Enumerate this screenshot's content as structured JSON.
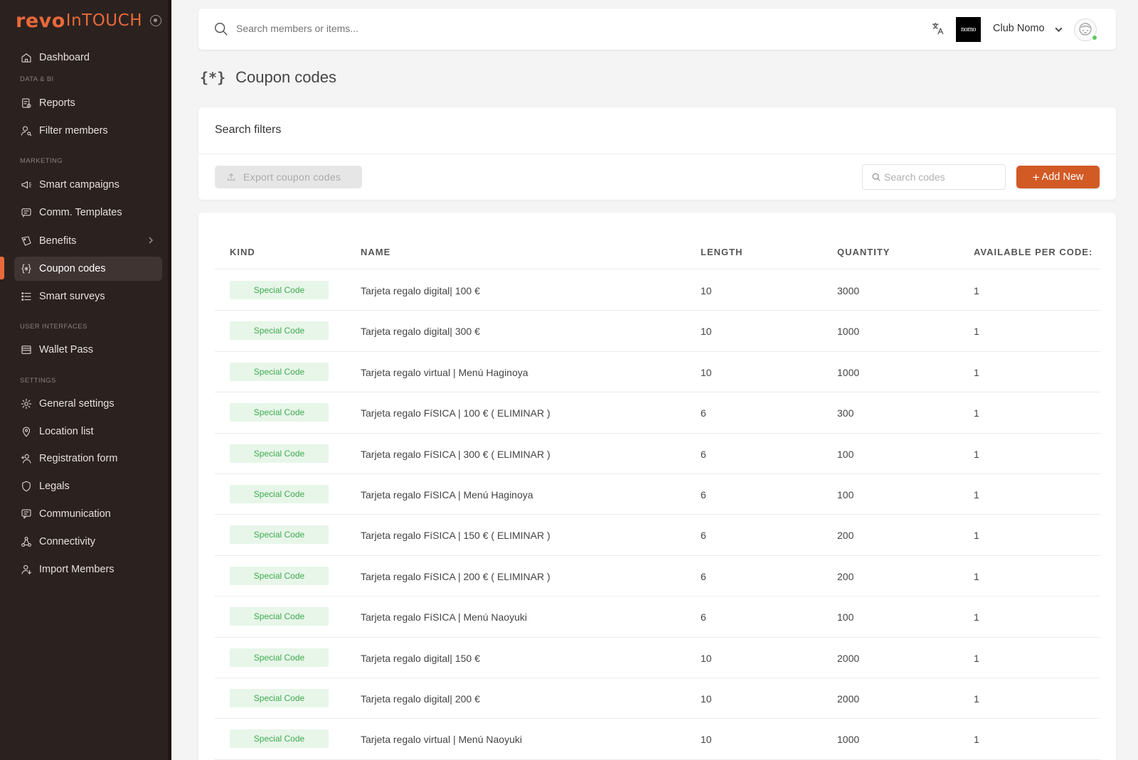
{
  "brand": {
    "logo_main": "revo",
    "logo_sub": "InTOUCH"
  },
  "sidebar": {
    "items": [
      {
        "id": "dashboard",
        "label": "Dashboard",
        "icon": "home-icon"
      },
      {
        "id": "reports",
        "label": "Reports",
        "icon": "reports-icon"
      },
      {
        "id": "filter-members",
        "label": "Filter members",
        "icon": "user-search-icon"
      },
      {
        "id": "smart-campaigns",
        "label": "Smart campaigns",
        "icon": "megaphone-icon"
      },
      {
        "id": "comm-templates",
        "label": "Comm. Templates",
        "icon": "message-icon"
      },
      {
        "id": "benefits",
        "label": "Benefits",
        "icon": "tag-icon"
      },
      {
        "id": "coupon-codes",
        "label": "Coupon codes",
        "icon": "braces-asterisk-icon"
      },
      {
        "id": "smart-surveys",
        "label": "Smart surveys",
        "icon": "list-icon"
      },
      {
        "id": "wallet-pass",
        "label": "Wallet Pass",
        "icon": "wallet-icon"
      },
      {
        "id": "general-settings",
        "label": "General settings",
        "icon": "gear-icon"
      },
      {
        "id": "location-list",
        "label": "Location list",
        "icon": "location-pin-icon"
      },
      {
        "id": "registration-form",
        "label": "Registration form",
        "icon": "user-add-icon"
      },
      {
        "id": "legals",
        "label": "Legals",
        "icon": "shield-icon"
      },
      {
        "id": "communication",
        "label": "Communication",
        "icon": "chat-icon"
      },
      {
        "id": "connectivity",
        "label": "Connectivity",
        "icon": "connectivity-icon"
      },
      {
        "id": "import-members",
        "label": "Import Members",
        "icon": "user-import-icon"
      }
    ],
    "sections": {
      "data_bi": "DATA & BI",
      "marketing": "MARKETING",
      "user_interfaces": "USER INTERFACES",
      "settings": "SETTINGS"
    },
    "active": "coupon-codes"
  },
  "topbar": {
    "search_placeholder": "Search members or items...",
    "club_logo_text": "nomo",
    "club_name": "Club Nomo"
  },
  "page": {
    "title": "Coupon codes",
    "title_icon": "{*}"
  },
  "filters": {
    "title": "Search filters",
    "export_label": "Export coupon codes",
    "search_placeholder": "Search codes",
    "add_label": "Add New",
    "add_symbol": "+"
  },
  "table": {
    "columns": [
      "KIND",
      "NAME",
      "LENGTH",
      "QUANTITY",
      "AVAILABLE PER CODE:"
    ],
    "rows": [
      {
        "kind": "Special Code",
        "name": "Tarjeta regalo digital| 100 €",
        "length": "10",
        "quantity": "3000",
        "available": "1"
      },
      {
        "kind": "Special Code",
        "name": "Tarjeta regalo digital| 300 €",
        "length": "10",
        "quantity": "1000",
        "available": "1"
      },
      {
        "kind": "Special Code",
        "name": "Tarjeta regalo virtual | Menú Haginoya",
        "length": "10",
        "quantity": "1000",
        "available": "1"
      },
      {
        "kind": "Special Code",
        "name": "Tarjeta regalo FíSICA | 100 € ( ELIMINAR )",
        "length": "6",
        "quantity": "300",
        "available": "1"
      },
      {
        "kind": "Special Code",
        "name": "Tarjeta regalo FíSICA | 300 € ( ELIMINAR )",
        "length": "6",
        "quantity": "100",
        "available": "1"
      },
      {
        "kind": "Special Code",
        "name": "Tarjeta regalo FíSICA | Menú Haginoya",
        "length": "6",
        "quantity": "100",
        "available": "1"
      },
      {
        "kind": "Special Code",
        "name": "Tarjeta regalo FíSICA | 150 € ( ELIMINAR )",
        "length": "6",
        "quantity": "200",
        "available": "1"
      },
      {
        "kind": "Special Code",
        "name": "Tarjeta regalo FíSICA | 200 € ( ELIMINAR )",
        "length": "6",
        "quantity": "200",
        "available": "1"
      },
      {
        "kind": "Special Code",
        "name": "Tarjeta regalo FíSICA | Menú Naoyuki",
        "length": "6",
        "quantity": "100",
        "available": "1"
      },
      {
        "kind": "Special Code",
        "name": "Tarjeta regalo digital| 150 €",
        "length": "10",
        "quantity": "2000",
        "available": "1"
      },
      {
        "kind": "Special Code",
        "name": "Tarjeta regalo digital| 200 €",
        "length": "10",
        "quantity": "2000",
        "available": "1"
      },
      {
        "kind": "Special Code",
        "name": "Tarjeta regalo virtual | Menú Naoyuki",
        "length": "10",
        "quantity": "1000",
        "available": "1"
      }
    ]
  },
  "colors": {
    "sidebar_bg": "#2b2220",
    "accent": "#e8693a",
    "primary_button": "#d25a25",
    "badge_bg": "#e7f6e9",
    "badge_text": "#3faa4f"
  }
}
